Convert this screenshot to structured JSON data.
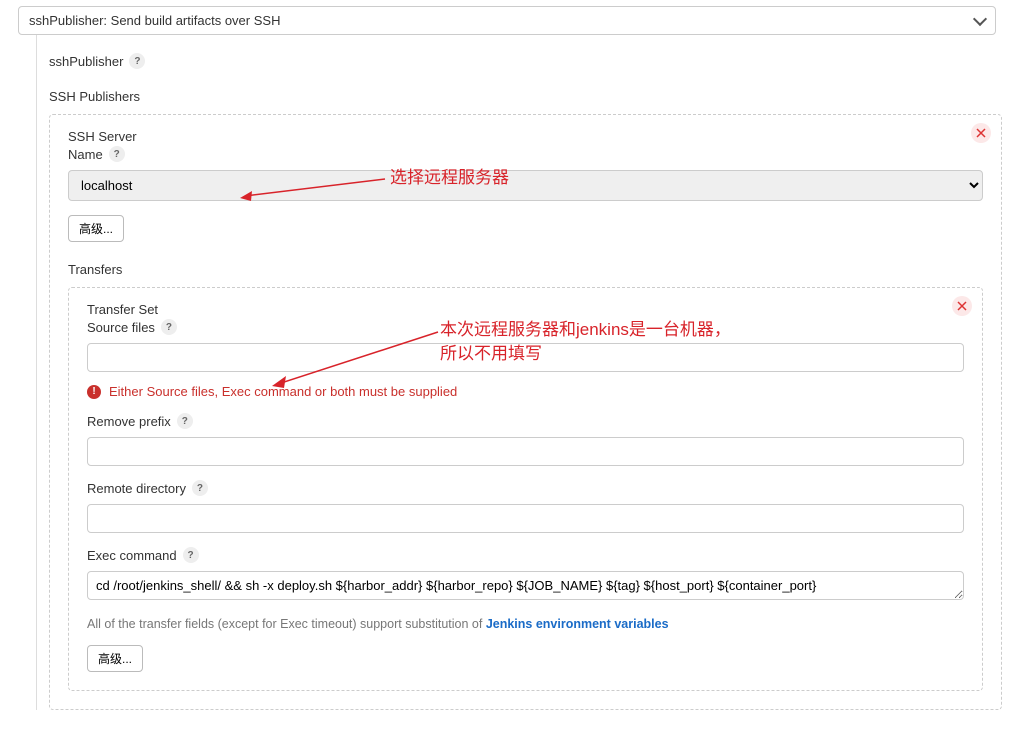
{
  "top_dropdown": {
    "label": "sshPublisher: Send build artifacts over SSH"
  },
  "sshPublisher_label": "sshPublisher",
  "ssh_publishers_title": "SSH Publishers",
  "server": {
    "name_label1": "SSH Server",
    "name_label2": "Name",
    "selected": "localhost",
    "advanced_btn": "高级..."
  },
  "transfers_title": "Transfers",
  "transfer": {
    "set_label": "Transfer Set",
    "source_files_label": "Source files",
    "source_files_value": "",
    "error_text": "Either Source files, Exec command or both must be supplied",
    "remove_prefix_label": "Remove prefix",
    "remove_prefix_value": "",
    "remote_dir_label": "Remote directory",
    "remote_dir_value": "",
    "exec_cmd_label": "Exec command",
    "exec_cmd_value": "cd /root/jenkins_shell/ && sh -x deploy.sh ${harbor_addr} ${harbor_repo} ${JOB_NAME} ${tag} ${host_port} ${container_port}",
    "hint_prefix": "All of the transfer fields (except for Exec timeout) support substitution of ",
    "hint_link": "Jenkins environment variables",
    "advanced_btn": "高级..."
  },
  "annotations": {
    "a1": "选择远程服务器",
    "a2_line1": "本次远程服务器和jenkins是一台机器，",
    "a2_line2": "所以不用填写"
  },
  "help_q": "?"
}
